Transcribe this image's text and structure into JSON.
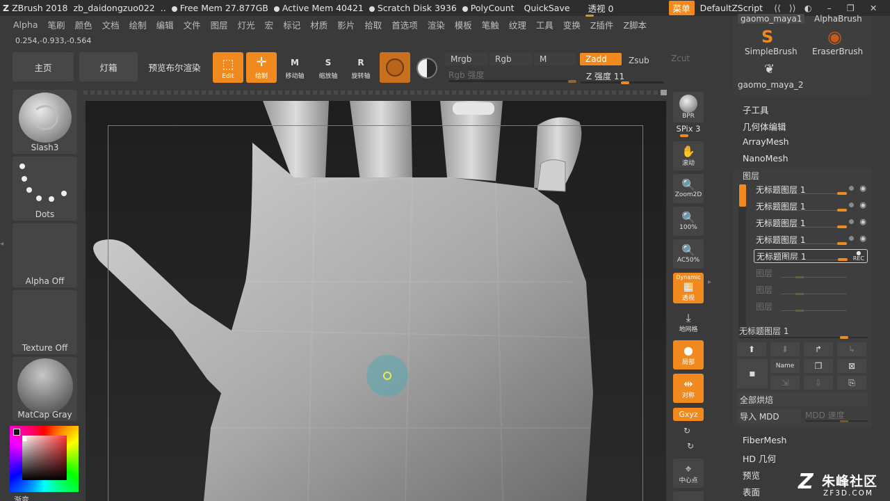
{
  "titlebar": {
    "app": "ZBrush 2018",
    "doc": "zb_daidongzuo022",
    "ellipsis": "..",
    "free_mem": "Free Mem 27.877GB",
    "active_mem": "Active Mem 40421",
    "scratch": "Scratch Disk 3936",
    "polycount": "PolyCount",
    "quicksave": "QuickSave",
    "perspective_label": "透视",
    "perspective_value": "0",
    "menu_btn": "菜单",
    "zscript": "DefaultZScript"
  },
  "menubar": [
    "Alpha",
    "笔刷",
    "颜色",
    "文档",
    "绘制",
    "编辑",
    "文件",
    "图层",
    "灯光",
    "宏",
    "标记",
    "材质",
    "影片",
    "拾取",
    "首选项",
    "渲染",
    "模板",
    "笔触",
    "纹理",
    "工具",
    "变换",
    "Z插件",
    "Z脚本"
  ],
  "coords": "0.254,-0.933,-0.564",
  "shelf": {
    "home": "主页",
    "lightbox": "灯箱",
    "bpr_preview": "预览布尔渲染",
    "edit": "Edit",
    "draw": "绘制",
    "move": "移动轴",
    "scale": "缩放轴",
    "rotate": "旋转轴",
    "mrgb": "Mrgb",
    "rgb": "Rgb",
    "m": "M",
    "zadd": "Zadd",
    "zsub": "Zsub",
    "zcut": "Zcut",
    "rgb_intensity": "Rgb 强度",
    "z_intensity": "Z 强度 11"
  },
  "leftpanel": {
    "brush": "Slash3",
    "stroke": "Dots",
    "alpha": "Alpha Off",
    "texture": "Texture Off",
    "material": "MatCap Gray",
    "gradient": "渐变"
  },
  "dock": {
    "bpr": "BPR",
    "spix": "SPix 3",
    "scroll": "滚动",
    "zoom2d": "Zoom2D",
    "actual": "100%",
    "ac50": "AC50%",
    "dynamic": "Dynamic",
    "persp": "透视",
    "floor": "地网格",
    "local": "局部",
    "sym": "对称",
    "xyz": "Gxyz",
    "center": "中心点"
  },
  "rightpanel": {
    "brushes": [
      {
        "name": "gaomo_maya1",
        "icon": "brush-icon"
      },
      {
        "name": "AlphaBrush",
        "icon": "brush-icon"
      },
      {
        "name": "SimpleBrush",
        "icon": "brush-icon"
      },
      {
        "name": "EraserBrush",
        "icon": "brush-icon"
      },
      {
        "name": "gaomo_maya_2",
        "icon": "brush-icon"
      }
    ],
    "subtool": "子工具",
    "geometry": "几何体编辑",
    "arraymesh": "ArrayMesh",
    "nanomesh": "NanoMesh",
    "layers": "图层",
    "layer_items": [
      "无标题图层 1",
      "无标题图层 1",
      "无标题图层 1",
      "无标题图层 1",
      "无标题图层 1"
    ],
    "empty_layers": [
      "图层",
      "图层",
      "图层"
    ],
    "rec": "REC",
    "current_layer": "无标题图层 1",
    "name_btn": "Name",
    "bake_all": "全部烘焙",
    "import_mdd": "导入 MDD",
    "mdd_speed": "MDD 速度",
    "fibermesh": "FiberMesh",
    "hd_geo": "HD 几何",
    "preview": "预览",
    "surface": "表面"
  },
  "watermark": {
    "text": "朱峰社区",
    "url": "ZF3D.COM"
  },
  "colors": {
    "accent": "#f08a1e",
    "bg": "#3a3a3a",
    "viewport": "#232323"
  }
}
